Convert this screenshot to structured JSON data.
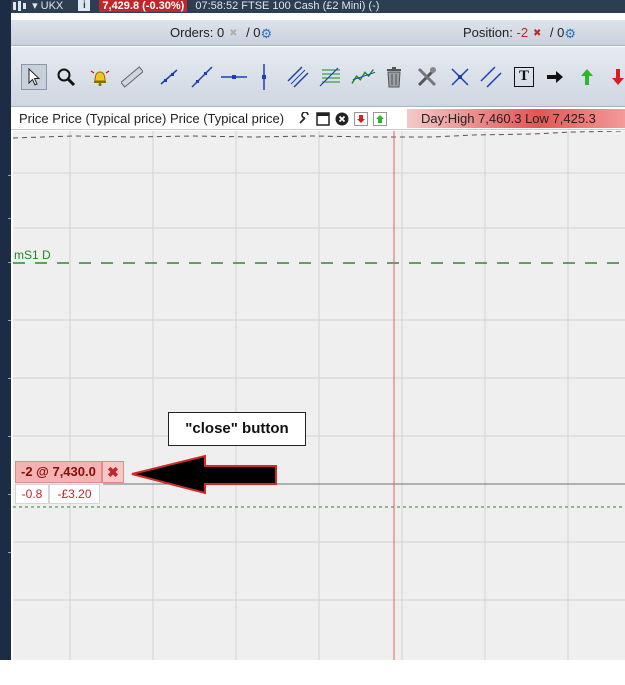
{
  "titlebar": {
    "symbol": "▾ UKX",
    "info_glyph": "i",
    "price_change": "7,429.8 (-0.30%)",
    "time_market": "07:58:52 FTSE 100 Cash (£2 Mini) (-)"
  },
  "ordersbar": {
    "orders_label": "Orders:",
    "orders_count": "0",
    "orders_total": "/ 0",
    "position_label": "Position:",
    "position_value": "-2",
    "position_total": "/ 0"
  },
  "toolbar": {
    "tools": [
      "pointer-icon",
      "zoom-icon",
      "alert-bell-icon",
      "ruler-icon",
      "line-icon",
      "trend-line-icon",
      "horizontal-line-icon",
      "vertical-line-icon",
      "parallel-channel-icon",
      "fibonacci-icon",
      "andrews-pitchfork-icon",
      "trash-icon",
      "tools-icon",
      "crosshair-icon",
      "ray-icon",
      "text-icon",
      "arrow-right-icon",
      "arrow-up-icon",
      "arrow-down-icon"
    ],
    "text_tool_glyph": "T"
  },
  "indicator": {
    "label": "Price Price (Typical price) Price (Typical price)",
    "day_high_low": "Day:High 7,460.3 Low 7,425.3"
  },
  "chart": {
    "level_label": "mS1 D"
  },
  "annotation": {
    "callout_text": "\"close\" button"
  },
  "position": {
    "tag": "-2 @ 7,430.0",
    "close_glyph": "✖",
    "pl_points": "-0.8",
    "pl_money": "-£3.20"
  },
  "colors": {
    "title_bg": "#2d3d52",
    "price_badge": "#c0262b",
    "support_line": "#1c8a1c",
    "cursor_line": "#e06060",
    "position_tag": "#f3b3b3"
  }
}
